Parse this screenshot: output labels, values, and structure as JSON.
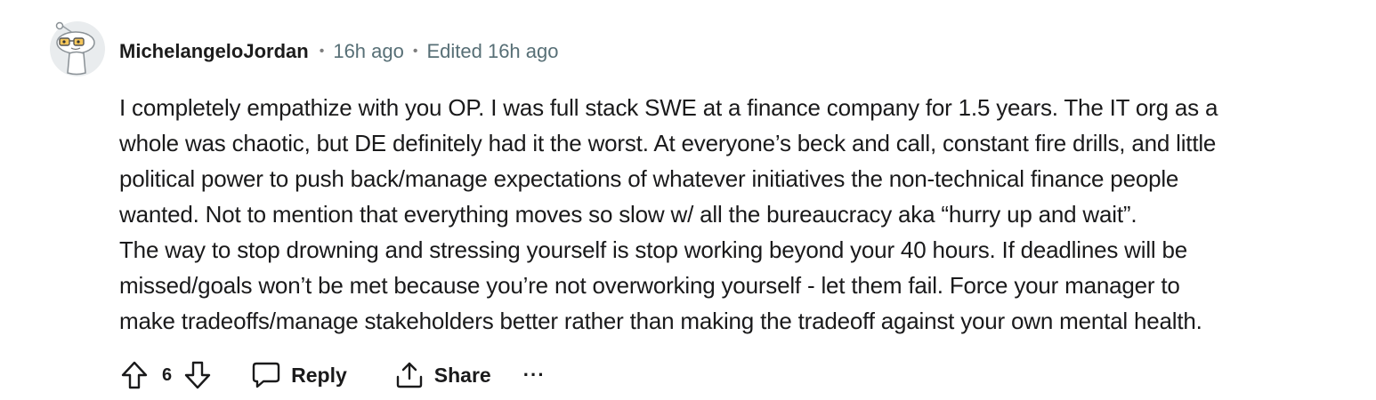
{
  "comment": {
    "author": "MichelangeloJordan",
    "separator": "•",
    "posted": "16h ago",
    "edited": "Edited 16h ago",
    "body_lines": [
      "I completely empathize with you OP. I was full stack SWE at a finance company for 1.5 years. The IT org as a",
      "whole was chaotic, but DE definitely had it the worst. At everyone’s beck and call, constant fire drills, and little",
      "political power to push back/manage expectations of whatever initiatives the non-technical finance people",
      "wanted. Not to mention that everything moves so slow w/ all the bureaucracy aka “hurry up and wait”.",
      "The way to stop drowning and stressing yourself is stop working beyond your 40 hours. If deadlines will be",
      "missed/goals won’t be met because you’re not overworking yourself - let them fail. Force your manager to",
      "make tradeoffs/manage stakeholders better rather than making the tradeoff against your own mental health."
    ],
    "score": "6"
  },
  "actions": {
    "reply_label": "Reply",
    "share_label": "Share",
    "more_label": "···"
  },
  "icons": {
    "upvote": "arrow-up-outline-icon",
    "downvote": "arrow-down-outline-icon",
    "reply": "speech-bubble-icon",
    "share": "share-tray-icon",
    "more": "ellipsis-icon"
  },
  "colors": {
    "text": "#1a1a1b",
    "meta": "#576f76",
    "icon": "#1a1a1b"
  }
}
